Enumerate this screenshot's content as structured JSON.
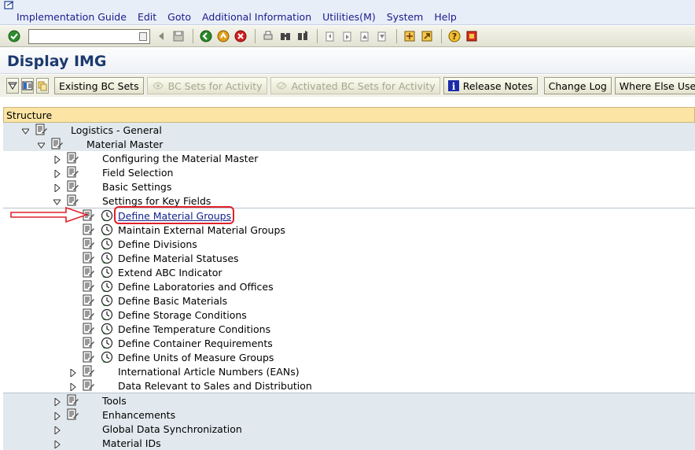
{
  "menubar": {
    "items": [
      "Implementation Guide",
      "Edit",
      "Goto",
      "Additional Information",
      "Utilities(M)",
      "System",
      "Help"
    ]
  },
  "toolbar": {
    "command_placeholder": "",
    "icons": [
      "enter-icon",
      "back-icon",
      "save-icon",
      "back-green-icon",
      "exit-icon",
      "cancel-icon",
      "print-icon",
      "find-icon",
      "find-next-icon",
      "first-page-icon",
      "prev-page-icon",
      "next-page-icon",
      "last-page-icon",
      "create-session-icon",
      "shortcut-icon",
      "help-icon",
      "layout-icon"
    ]
  },
  "title": "Display IMG",
  "app_toolbar": {
    "existing_bc_sets": "Existing BC Sets",
    "bc_sets_for_activity": "BC Sets for Activity",
    "activated_bc_sets": "Activated BC Sets for Activity",
    "release_notes": "Release Notes",
    "change_log": "Change Log",
    "where_else_used": "Where Else Used"
  },
  "tree": {
    "header": "Structure",
    "logistics_general": "Logistics - General",
    "material_master": "Material Master",
    "configuring": "Configuring the Material Master",
    "field_selection": "Field Selection",
    "basic_settings": "Basic Settings",
    "settings_key_fields": "Settings for Key Fields",
    "activities": [
      "Define Material Groups",
      "Maintain External Material Groups",
      "Define Divisions",
      "Define Material Statuses",
      "Extend ABC Indicator",
      "Define Laboratories and Offices",
      "Define Basic Materials",
      "Define Storage Conditions",
      "Define Temperature Conditions",
      "Define Container Requirements",
      "Define Units of Measure Groups"
    ],
    "eans": "International Article Numbers (EANs)",
    "sales_distribution": "Data Relevant to Sales and Distribution",
    "tools": "Tools",
    "enhancements": "Enhancements",
    "global_sync": "Global Data Synchronization",
    "material_ids": "Material IDs"
  },
  "colors": {
    "header_bg": "#fbe4a4",
    "shaded_row": "#e1e9ee",
    "highlight": "#e0202a",
    "link": "#14218c",
    "title": "#1c3a6e"
  }
}
